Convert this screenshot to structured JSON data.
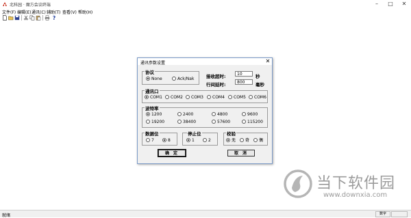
{
  "window": {
    "title": "北科园 · 魔方会议终端",
    "minimize": "–",
    "maximize": "□",
    "close": "✕"
  },
  "menu": [
    "文件(F)",
    "编辑(E)",
    "通讯(C)",
    "辅助(T)",
    "查看(V)",
    "帮助(H)"
  ],
  "toolbar_icons": [
    "new-icon",
    "open-icon",
    "save-icon",
    "cut-icon",
    "copy-icon",
    "paste-icon",
    "print-icon",
    "help-icon"
  ],
  "dialog": {
    "title": "通讯参数设置",
    "close": "✕",
    "protocol": {
      "title": "协议",
      "options": [
        "None",
        "Ack/Nak"
      ],
      "selected": "None"
    },
    "timeouts": {
      "recv_label": "接收超时:",
      "recv_value": "10",
      "recv_unit": "秒",
      "row_label": "行间延时:",
      "row_value": "800",
      "row_unit": "毫秒"
    },
    "port": {
      "title": "通讯口",
      "options": [
        "COM1",
        "COM2",
        "COM3",
        "COM4",
        "COM5",
        "COM6"
      ],
      "selected": "COM1"
    },
    "baud": {
      "title": "波特率",
      "options": [
        "1200",
        "2400",
        "4800",
        "9600",
        "19200",
        "38400",
        "57600",
        "115200"
      ],
      "selected": "1200"
    },
    "databits": {
      "title": "数据位",
      "options": [
        "7",
        "8"
      ],
      "selected": "8"
    },
    "stopbits": {
      "title": "停止位",
      "options": [
        "1",
        "2"
      ],
      "selected": "1"
    },
    "parity": {
      "title": "校验",
      "options": [
        "无",
        "奇",
        "偶"
      ],
      "selected": "无"
    },
    "ok_label": "确 定",
    "cancel_label": "取 消"
  },
  "statusbar": {
    "left": "就绪",
    "right": "数字"
  },
  "watermark": {
    "brand": "当下软件园",
    "url": "www.downxia.com",
    "color": "#9b9b9b"
  },
  "colors": {
    "accent": "#7a9ac8",
    "logo_red": "#c8301e"
  }
}
